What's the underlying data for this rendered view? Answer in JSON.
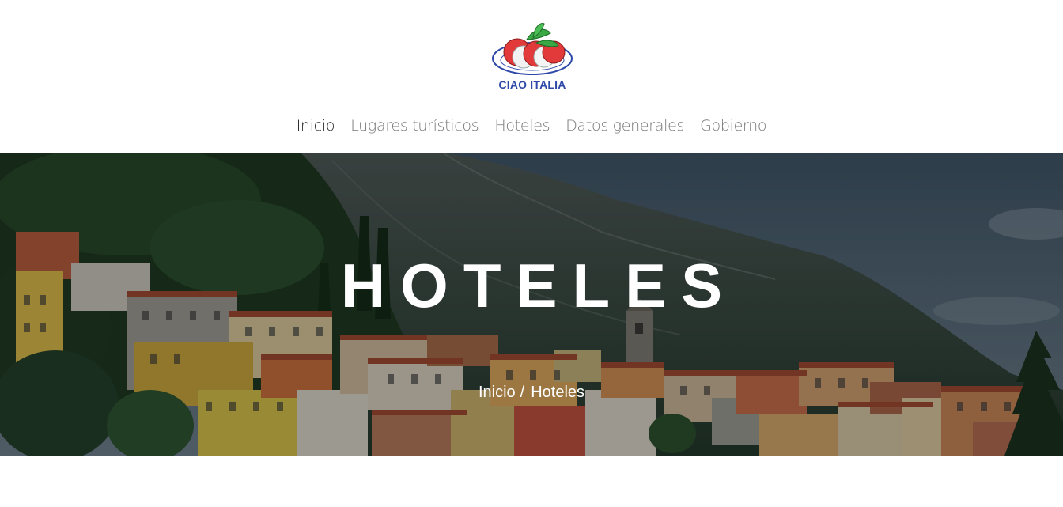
{
  "brand": {
    "name": "CIAO ITALIA",
    "logo_icon": "caprese-plate-icon",
    "colors": {
      "blue": "#2f49a8",
      "red": "#e23a3a",
      "green": "#3aa845"
    }
  },
  "nav": {
    "items": [
      {
        "label": "Inicio",
        "active": true
      },
      {
        "label": "Lugares turísticos",
        "active": false
      },
      {
        "label": "Hoteles",
        "active": false
      },
      {
        "label": "Datos generales",
        "active": false
      },
      {
        "label": "Gobierno",
        "active": false
      }
    ]
  },
  "hero": {
    "title": "HOTELES",
    "background": "lake-village-mountain-image",
    "breadcrumb": {
      "home": "Inicio",
      "separator": "/",
      "current": "Hoteles"
    }
  }
}
